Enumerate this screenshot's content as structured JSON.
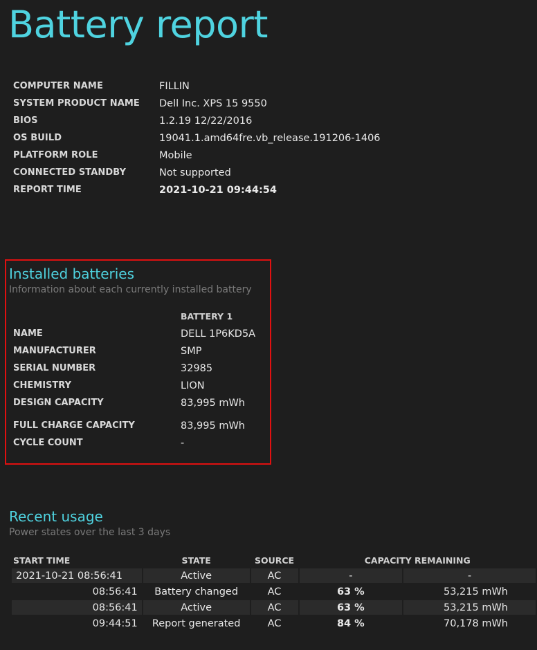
{
  "page": {
    "title": "Battery report"
  },
  "system_info": [
    {
      "label": "COMPUTER NAME",
      "value": "FILLIN"
    },
    {
      "label": "SYSTEM PRODUCT NAME",
      "value": "Dell Inc. XPS 15 9550"
    },
    {
      "label": "BIOS",
      "value": "1.2.19 12/22/2016"
    },
    {
      "label": "OS BUILD",
      "value": "19041.1.amd64fre.vb_release.191206-1406"
    },
    {
      "label": "PLATFORM ROLE",
      "value": "Mobile"
    },
    {
      "label": "CONNECTED STANDBY",
      "value": "Not supported"
    },
    {
      "label": "REPORT TIME",
      "value": "2021-10-21  09:44:54"
    }
  ],
  "installed_batteries": {
    "title": "Installed batteries",
    "subtitle": "Information about each currently installed battery",
    "column_header": "BATTERY 1",
    "rows": [
      {
        "label": "NAME",
        "value": "DELL 1P6KD5A"
      },
      {
        "label": "MANUFACTURER",
        "value": "SMP"
      },
      {
        "label": "SERIAL NUMBER",
        "value": "32985"
      },
      {
        "label": "CHEMISTRY",
        "value": "LION"
      },
      {
        "label": "DESIGN CAPACITY",
        "value": "83,995 mWh"
      },
      {
        "label": "FULL CHARGE CAPACITY",
        "value": "83,995 mWh"
      },
      {
        "label": "CYCLE COUNT",
        "value": "-"
      }
    ],
    "highlight_color": "#e01010"
  },
  "recent_usage": {
    "title": "Recent usage",
    "subtitle": "Power states over the last 3 days",
    "headers": {
      "start_time": "START TIME",
      "state": "STATE",
      "source": "SOURCE",
      "capacity": "CAPACITY REMAINING"
    },
    "rows": [
      {
        "start": "2021-10-21  08:56:41",
        "state": "Active",
        "source": "AC",
        "pct": "-",
        "mwh": "-"
      },
      {
        "start": "08:56:41",
        "state": "Battery changed",
        "source": "AC",
        "pct": "63 %",
        "mwh": "53,215 mWh"
      },
      {
        "start": "08:56:41",
        "state": "Active",
        "source": "AC",
        "pct": "63 %",
        "mwh": "53,215 mWh"
      },
      {
        "start": "09:44:51",
        "state": "Report generated",
        "source": "AC",
        "pct": "84 %",
        "mwh": "70,178 mWh"
      }
    ]
  },
  "colors": {
    "background": "#1e1e1e",
    "accent": "#4fd3e0",
    "row_alt": "#2b2b2b"
  }
}
